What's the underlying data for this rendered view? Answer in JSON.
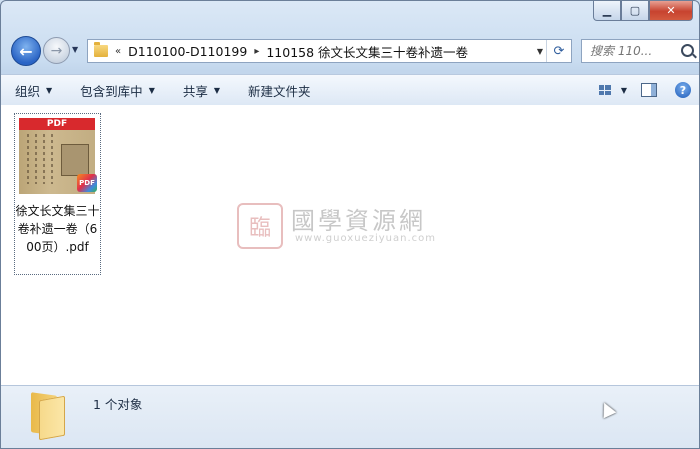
{
  "window": {
    "minimize_glyph": "▁",
    "maximize_glyph": "▢",
    "close_glyph": "✕"
  },
  "nav": {
    "back_glyph": "←",
    "forward_glyph": "→",
    "history_glyph": "▼"
  },
  "address": {
    "overflow_glyph": "«",
    "crumbs": [
      "D110100-D110199",
      "110158 徐文长文集三十卷补遗一卷"
    ],
    "separator_glyph": "▸",
    "dropdown_glyph": "▼",
    "refresh_glyph": "⟳"
  },
  "search": {
    "placeholder": "搜索 110..."
  },
  "toolbar": {
    "organize": "组织",
    "include_in_library": "包含到库中",
    "share": "共享",
    "new_folder": "新建文件夹",
    "dropdown_glyph": "▼",
    "help_glyph": "?"
  },
  "files": [
    {
      "name": "徐文长文集三十卷补遗一卷（600页）.pdf",
      "thumb_label": "PDF",
      "badge_label": "PDF"
    }
  ],
  "watermark": {
    "seal_glyph": "臨",
    "chinese": "國學資源網",
    "url": "www.guoxueziyuan.com"
  },
  "status": {
    "count": "1 个对象"
  },
  "colors": {
    "titlebar": "#dbe8f6",
    "toolbar": "#e8f0f9",
    "content_bg": "#ffffff",
    "pdf_red": "#d8292d",
    "close_red": "#c7432f"
  }
}
